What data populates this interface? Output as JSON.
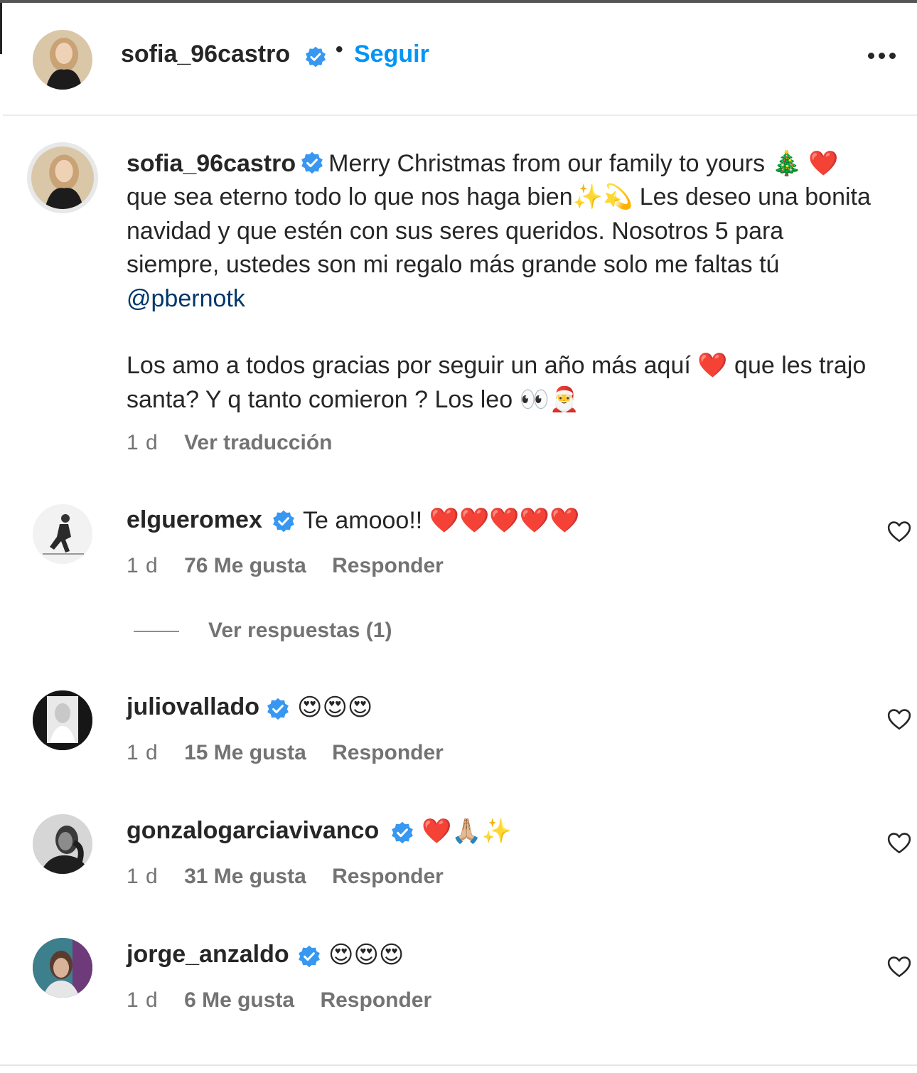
{
  "post": {
    "author": "sofia_96castro",
    "follow_label": "Seguir",
    "separator": "•",
    "more_label": "More options"
  },
  "caption": {
    "username": "sofia_96castro",
    "line1": "Merry Christmas from our family to yours 🎄 ❤️ que sea eterno todo lo que nos haga bien✨💫 Les deseo una bonita navidad y que estén con sus seres queridos. Nosotros 5 para siempre, ustedes son mi regalo más grande solo me faltas tú ",
    "mention": "@pbernotk",
    "line2": "Los amo a todos gracias por seguir un año más aquí ❤️ que les trajo santa? Y q tanto comieron ? Los leo 👀🎅",
    "time": "1 d",
    "translate_label": "Ver traducción"
  },
  "comments": [
    {
      "username": "elgueromex",
      "text": "Te amooo!! ❤️❤️❤️❤️❤️",
      "time": "1 d",
      "likes": "76 Me gusta",
      "reply": "Responder"
    },
    {
      "username": "juliovallado",
      "text": "😍😍😍",
      "time": "1 d",
      "likes": "15 Me gusta",
      "reply": "Responder"
    },
    {
      "username": "gonzalogarciavivanco",
      "text": "❤️🙏🏼✨",
      "time": "1 d",
      "likes": "31 Me gusta",
      "reply": "Responder"
    },
    {
      "username": "jorge_anzaldo",
      "text": "😍😍😍",
      "time": "1 d",
      "likes": "6 Me gusta",
      "reply": "Responder"
    }
  ],
  "view_replies_label": "Ver respuestas (1)",
  "colors": {
    "follow": "#0095f6",
    "verified": "#3897f0",
    "mention": "#00376b",
    "meta": "#737373"
  },
  "icons": [
    "verified-badge-icon",
    "more-options-icon",
    "heart-outline-icon"
  ]
}
